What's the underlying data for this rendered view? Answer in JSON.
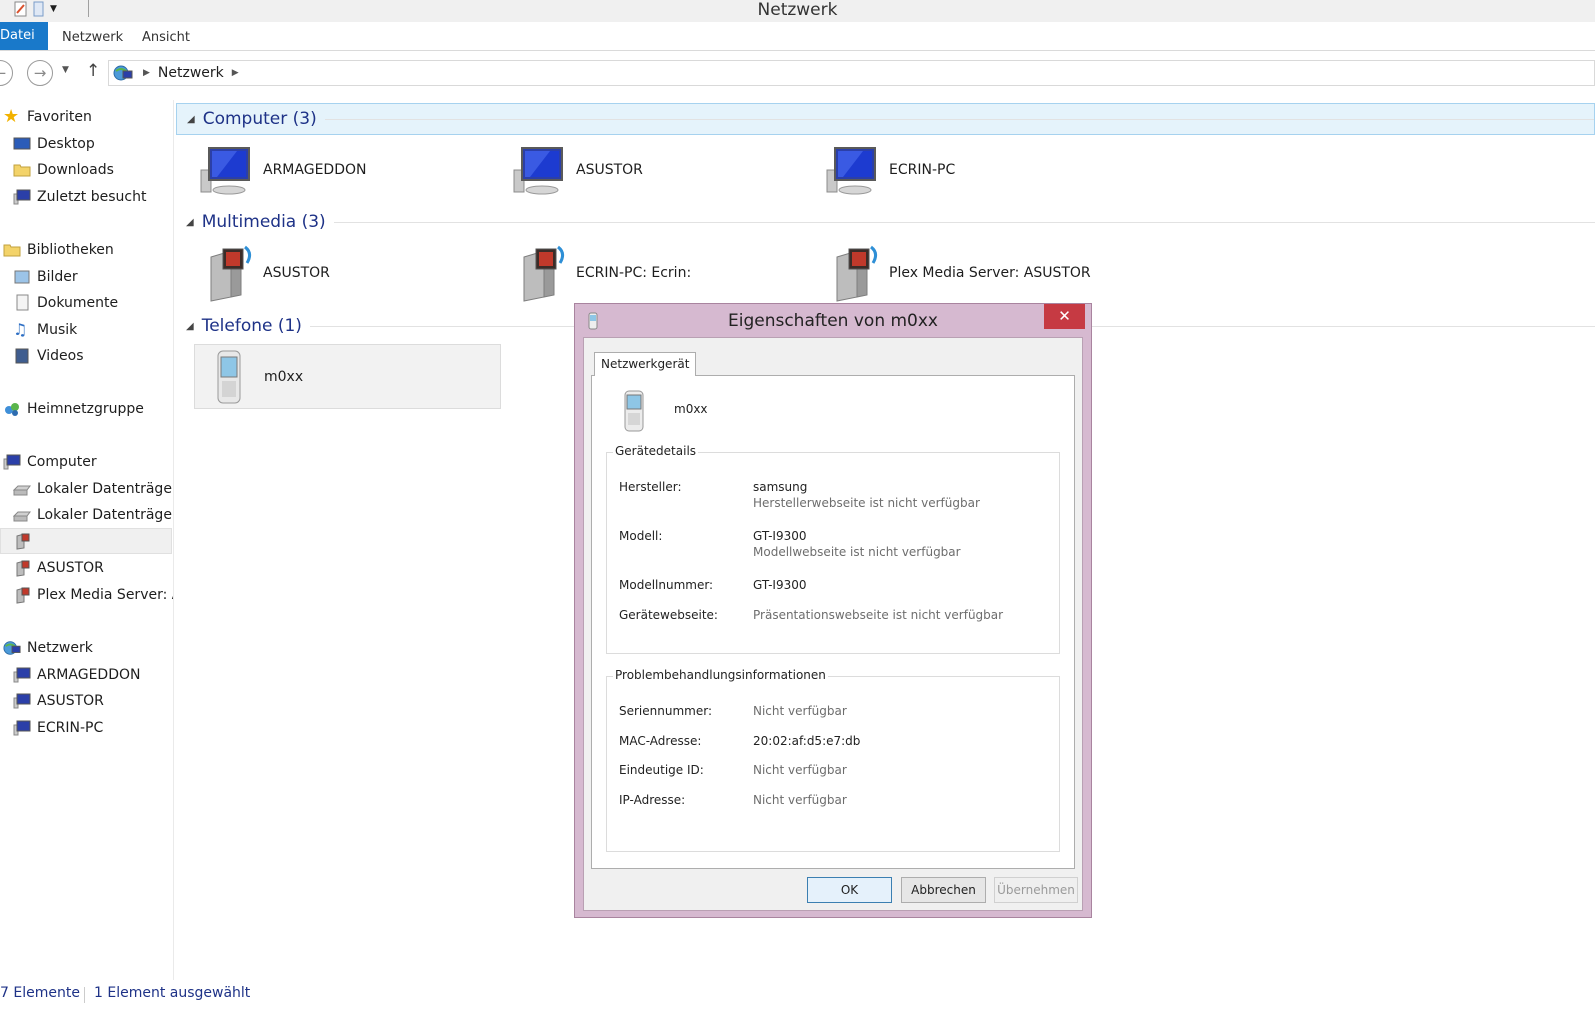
{
  "window": {
    "title": "Netzwerk"
  },
  "ribbon": {
    "tabs": [
      "Datei",
      "Netzwerk",
      "Ansicht"
    ]
  },
  "address": {
    "path": "Netzwerk"
  },
  "sidebar": {
    "favorites": {
      "label": "Favoriten",
      "items": [
        "Desktop",
        "Downloads",
        "Zuletzt besucht"
      ]
    },
    "libraries": {
      "label": "Bibliotheken",
      "items": [
        "Bilder",
        "Dokumente",
        "Musik",
        "Videos"
      ]
    },
    "homegroup": {
      "label": "Heimnetzgruppe"
    },
    "computer": {
      "label": "Computer",
      "items": [
        "Lokaler Datenträger",
        "Lokaler Datenträger",
        "",
        "ASUSTOR",
        "Plex Media Server: AS"
      ]
    },
    "network": {
      "label": "Netzwerk",
      "items": [
        "ARMAGEDDON",
        "ASUSTOR",
        "ECRIN-PC"
      ]
    }
  },
  "groups": {
    "computer": {
      "title": "Computer (3)",
      "items": [
        "ARMAGEDDON",
        "ASUSTOR",
        "ECRIN-PC"
      ]
    },
    "multimedia": {
      "title": "Multimedia (3)",
      "items": [
        "ASUSTOR",
        "ECRIN-PC: Ecrin:",
        "Plex Media Server: ASUSTOR"
      ]
    },
    "phones": {
      "title": "Telefone (1)",
      "items": [
        "m0xx"
      ]
    }
  },
  "status": {
    "count": "7 Elemente",
    "selected": "1 Element ausgewählt"
  },
  "dialog": {
    "title": "Eigenschaften von m0xx",
    "tab": "Netzwerkgerät",
    "device_name": "m0xx",
    "details": {
      "legend": "Gerätedetails",
      "manufacturer_label": "Hersteller:",
      "manufacturer_value": "samsung",
      "manufacturer_sub": "Herstellerwebseite ist nicht verfügbar",
      "model_label": "Modell:",
      "model_value": "GT-I9300",
      "model_sub": "Modellwebseite ist nicht verfügbar",
      "modelnum_label": "Modellnummer:",
      "modelnum_value": "GT-I9300",
      "web_label": "Gerätewebseite:",
      "web_value": "Präsentationswebseite ist nicht verfügbar"
    },
    "trouble": {
      "legend": "Problembehandlungsinformationen",
      "serial_label": "Seriennummer:",
      "serial_value": "Nicht verfügbar",
      "mac_label": "MAC-Adresse:",
      "mac_value": "20:02:af:d5:e7:db",
      "uid_label": "Eindeutige ID:",
      "uid_value": "Nicht verfügbar",
      "ip_label": "IP-Adresse:",
      "ip_value": "Nicht verfügbar"
    },
    "buttons": {
      "ok": "OK",
      "cancel": "Abbrechen",
      "apply": "Übernehmen"
    },
    "close_glyph": "✕"
  },
  "colors": {
    "accent": "#1979ca",
    "group_title": "#1e3287",
    "dialog_frame": "#d6b9d0",
    "close": "#c63a43"
  }
}
